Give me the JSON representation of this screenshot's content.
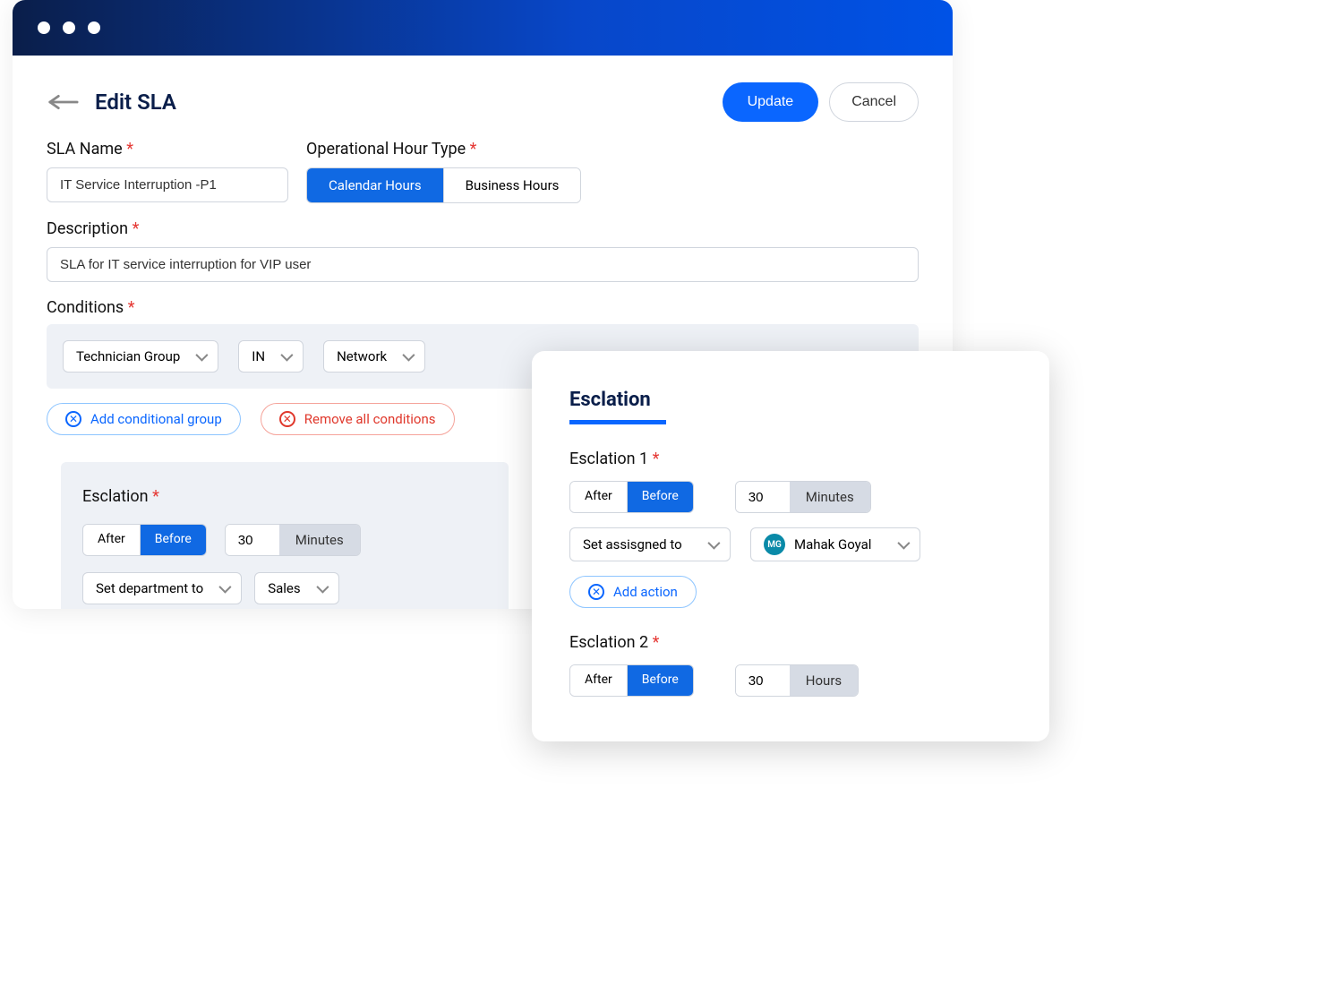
{
  "header": {
    "title": "Edit SLA",
    "update": "Update",
    "cancel": "Cancel"
  },
  "sla_name": {
    "label": "SLA Name",
    "value": "IT Service Interruption -P1"
  },
  "op_hour": {
    "label": "Operational Hour Type",
    "calendar": "Calendar Hours",
    "business": "Business Hours"
  },
  "description": {
    "label": "Description",
    "value": "SLA for IT service interruption for VIP user"
  },
  "conditions": {
    "label": "Conditions",
    "field": "Technician Group",
    "op": "IN",
    "value": "Network",
    "add_group": "Add conditional group",
    "remove_all": "Remove all conditions"
  },
  "left_escalation": {
    "title": "Esclation",
    "after": "After",
    "before": "Before",
    "amount": "30",
    "unit": "Minutes",
    "set_dept": "Set department to",
    "dept_value": "Sales"
  },
  "popup": {
    "title": "Esclation",
    "esc1_label": "Esclation 1",
    "e1_after": "After",
    "e1_before": "Before",
    "e1_amount": "30",
    "e1_unit": "Minutes",
    "set_assigned": "Set assisgned to",
    "assignee_initials": "MG",
    "assignee_name": "Mahak Goyal",
    "add_action": "Add action",
    "esc2_label": "Esclation 2",
    "e2_after": "After",
    "e2_before": "Before",
    "e2_amount": "30",
    "e2_unit": "Hours"
  }
}
